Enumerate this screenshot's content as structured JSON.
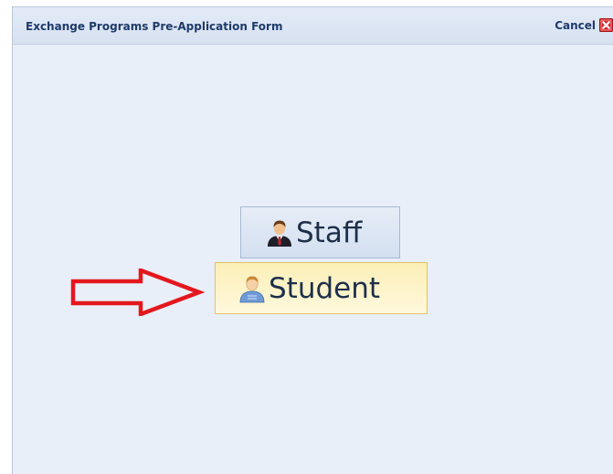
{
  "dialog": {
    "title": "Exchange Programs Pre-Application Form",
    "cancel_label": "Cancel"
  },
  "choices": {
    "staff_label": "Staff",
    "student_label": "Student"
  },
  "colors": {
    "title_text": "#1e3a6a",
    "background": "#e9eff9",
    "highlight": "#fbefb7",
    "annotation_arrow": "#e3181e"
  },
  "icons": {
    "cancel": "close-icon",
    "staff": "staff-user-icon",
    "student": "student-user-icon",
    "annotation": "red-arrow-annotation"
  }
}
